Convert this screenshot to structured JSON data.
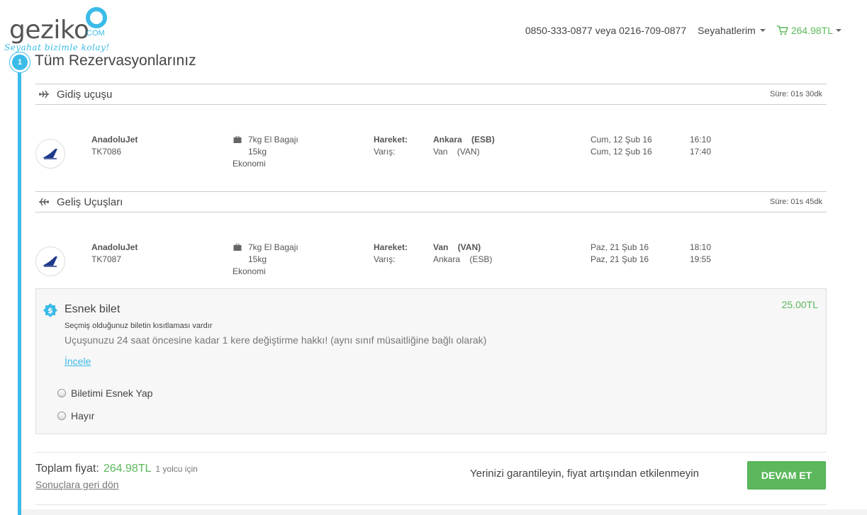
{
  "brand": {
    "logo_text": "geziko",
    "logo_suffix": ".COM",
    "slogan": "Seyahat bizimle kolay!",
    "accent_color": "#3bbbe8",
    "price_color": "#5cb85c"
  },
  "header": {
    "phone": "0850-333-0877 veya 0216-709-0877",
    "trips_label": "Seyahatlerim",
    "cart_total": "264.98TL"
  },
  "step": {
    "number": "1",
    "title": "Tüm Rezervasyonlarınız"
  },
  "outbound": {
    "title": "Gidiş uçuşu",
    "duration": "Süre: 01s 30dk",
    "airline": "AnadoluJet",
    "flight_no": "TK7086",
    "bag_line1": "7kg El Bagajı",
    "bag_line2": "15kg",
    "cabin": "Ekonomi",
    "dep_label": "Hareket:",
    "arr_label": "Varış:",
    "dep_city": "Ankara    (ESB)",
    "arr_city": "Van    (VAN)",
    "dep_date": "Cum, 12 Şub 16",
    "arr_date": "Cum, 12 Şub 16",
    "dep_time": "16:10",
    "arr_time": "17:40"
  },
  "return": {
    "title": "Geliş Uçuşları",
    "duration": "Süre: 01s 45dk",
    "airline": "AnadoluJet",
    "flight_no": "TK7087",
    "bag_line1": "7kg El Bagajı",
    "bag_line2": "15kg",
    "cabin": "Ekonomi",
    "dep_label": "Hareket:",
    "arr_label": "Varış:",
    "dep_city": "Van    (VAN)",
    "arr_city": "Ankara    (ESB)",
    "dep_date": "Paz, 21 Şub 16",
    "arr_date": "Paz, 21 Şub 16",
    "dep_time": "18:10",
    "arr_time": "19:55"
  },
  "flex_ticket": {
    "title": "Esnek bilet",
    "price": "25.00TL",
    "subtitle": "Seçmiş olduğunuz biletin kısıtlaması vardır",
    "description": "Uçuşunuzu 24 saat öncesine kadar 1 kere değiştirme hakkı! (aynı sınıf müsaitliğine bağlı olarak)",
    "link": "İncele",
    "option_yes": "Biletimi Esnek Yap",
    "option_no": "Hayır"
  },
  "footer": {
    "total_label": "Toplam fiyat:",
    "total_price": "264.98TL",
    "total_pax": "1 yolcu için",
    "back_link": "Sonuçlara geri dön",
    "guarantee": "Yerinizi garantileyin, fiyat artışından etkilenmeyin",
    "continue": "DEVAM ET"
  }
}
